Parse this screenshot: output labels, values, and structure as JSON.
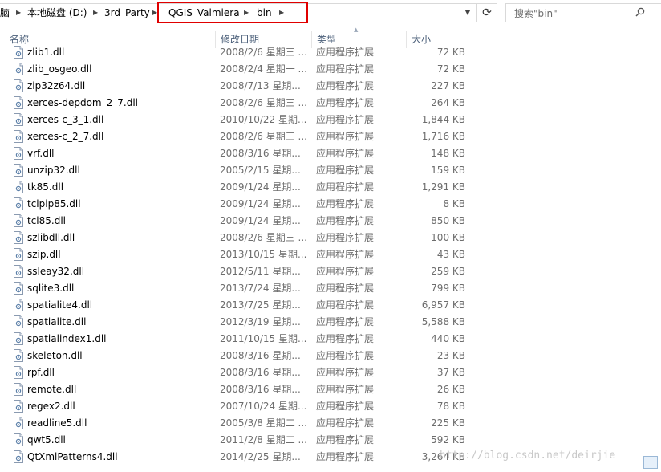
{
  "breadcrumb": {
    "items": [
      "脑",
      "本地磁盘 (D:)",
      "3rd_Party",
      "QGIS_Valmiera",
      "bin"
    ]
  },
  "search": {
    "placeholder": "搜索\"bin\""
  },
  "columns": {
    "name": "名称",
    "date": "修改日期",
    "type": "类型",
    "size": "大小"
  },
  "files": [
    {
      "name": "zlib1.dll",
      "date": "2008/2/6 星期三 ...",
      "type": "应用程序扩展",
      "size": "72 KB"
    },
    {
      "name": "zlib_osgeo.dll",
      "date": "2008/2/4 星期一 ...",
      "type": "应用程序扩展",
      "size": "72 KB"
    },
    {
      "name": "zip32z64.dll",
      "date": "2008/7/13 星期...",
      "type": "应用程序扩展",
      "size": "227 KB"
    },
    {
      "name": "xerces-depdom_2_7.dll",
      "date": "2008/2/6 星期三 ...",
      "type": "应用程序扩展",
      "size": "264 KB"
    },
    {
      "name": "xerces-c_3_1.dll",
      "date": "2010/10/22 星期...",
      "type": "应用程序扩展",
      "size": "1,844 KB"
    },
    {
      "name": "xerces-c_2_7.dll",
      "date": "2008/2/6 星期三 ...",
      "type": "应用程序扩展",
      "size": "1,716 KB"
    },
    {
      "name": "vrf.dll",
      "date": "2008/3/16 星期...",
      "type": "应用程序扩展",
      "size": "148 KB"
    },
    {
      "name": "unzip32.dll",
      "date": "2005/2/15 星期...",
      "type": "应用程序扩展",
      "size": "159 KB"
    },
    {
      "name": "tk85.dll",
      "date": "2009/1/24 星期...",
      "type": "应用程序扩展",
      "size": "1,291 KB"
    },
    {
      "name": "tclpip85.dll",
      "date": "2009/1/24 星期...",
      "type": "应用程序扩展",
      "size": "8 KB"
    },
    {
      "name": "tcl85.dll",
      "date": "2009/1/24 星期...",
      "type": "应用程序扩展",
      "size": "850 KB"
    },
    {
      "name": "szlibdll.dll",
      "date": "2008/2/6 星期三 ...",
      "type": "应用程序扩展",
      "size": "100 KB"
    },
    {
      "name": "szip.dll",
      "date": "2013/10/15 星期...",
      "type": "应用程序扩展",
      "size": "43 KB"
    },
    {
      "name": "ssleay32.dll",
      "date": "2012/5/11 星期...",
      "type": "应用程序扩展",
      "size": "259 KB"
    },
    {
      "name": "sqlite3.dll",
      "date": "2013/7/24 星期...",
      "type": "应用程序扩展",
      "size": "799 KB"
    },
    {
      "name": "spatialite4.dll",
      "date": "2013/7/25 星期...",
      "type": "应用程序扩展",
      "size": "6,957 KB"
    },
    {
      "name": "spatialite.dll",
      "date": "2012/3/19 星期...",
      "type": "应用程序扩展",
      "size": "5,588 KB"
    },
    {
      "name": "spatialindex1.dll",
      "date": "2011/10/15 星期...",
      "type": "应用程序扩展",
      "size": "440 KB"
    },
    {
      "name": "skeleton.dll",
      "date": "2008/3/16 星期...",
      "type": "应用程序扩展",
      "size": "23 KB"
    },
    {
      "name": "rpf.dll",
      "date": "2008/3/16 星期...",
      "type": "应用程序扩展",
      "size": "37 KB"
    },
    {
      "name": "remote.dll",
      "date": "2008/3/16 星期...",
      "type": "应用程序扩展",
      "size": "26 KB"
    },
    {
      "name": "regex2.dll",
      "date": "2007/10/24 星期...",
      "type": "应用程序扩展",
      "size": "78 KB"
    },
    {
      "name": "readline5.dll",
      "date": "2005/3/8 星期二 ...",
      "type": "应用程序扩展",
      "size": "225 KB"
    },
    {
      "name": "qwt5.dll",
      "date": "2011/2/8 星期二 ...",
      "type": "应用程序扩展",
      "size": "592 KB"
    },
    {
      "name": "QtXmlPatterns4.dll",
      "date": "2014/2/25 星期...",
      "type": "应用程序扩展",
      "size": "3,264 KB"
    }
  ],
  "watermark": "http://blog.csdn.net/deirjie",
  "colors": {
    "highlight": "#e00000",
    "header_text": "#4c607a",
    "meta_text": "#6d6d6d"
  }
}
